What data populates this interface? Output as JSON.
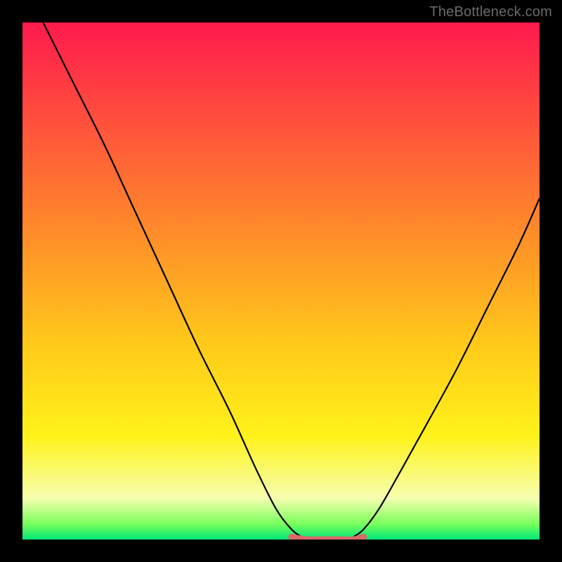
{
  "watermark": "TheBottleneck.com",
  "gradient": {
    "top": "#ff1a4d",
    "c1": "#ff4d3d",
    "c2": "#ff8a2a",
    "c3": "#ffc91a",
    "c4": "#fff21a",
    "c5": "#f6ffb0",
    "c6": "#79ff5c",
    "bot": "#00e676"
  },
  "chart_data": {
    "type": "line",
    "title": "",
    "xlabel": "",
    "ylabel": "",
    "xlim": [
      0,
      100
    ],
    "ylim": [
      0,
      100
    ],
    "series": [
      {
        "name": "left-curve",
        "x": [
          4,
          10,
          16,
          22,
          28,
          34,
          40,
          45,
          49,
          52,
          54
        ],
        "values": [
          100,
          88,
          76,
          63,
          50,
          37,
          25,
          14,
          6,
          2,
          0.5
        ]
      },
      {
        "name": "right-curve",
        "x": [
          64,
          66,
          69,
          73,
          78,
          84,
          90,
          96,
          100
        ],
        "values": [
          0.5,
          2,
          6,
          13,
          22,
          33,
          45,
          57,
          66
        ]
      },
      {
        "name": "flat-segment",
        "x": [
          52,
          55,
          58,
          61,
          64,
          66
        ],
        "values": [
          0.5,
          0,
          0,
          0,
          0,
          0.5
        ],
        "highlight": true
      }
    ],
    "highlight_color": "#d96a6a"
  }
}
